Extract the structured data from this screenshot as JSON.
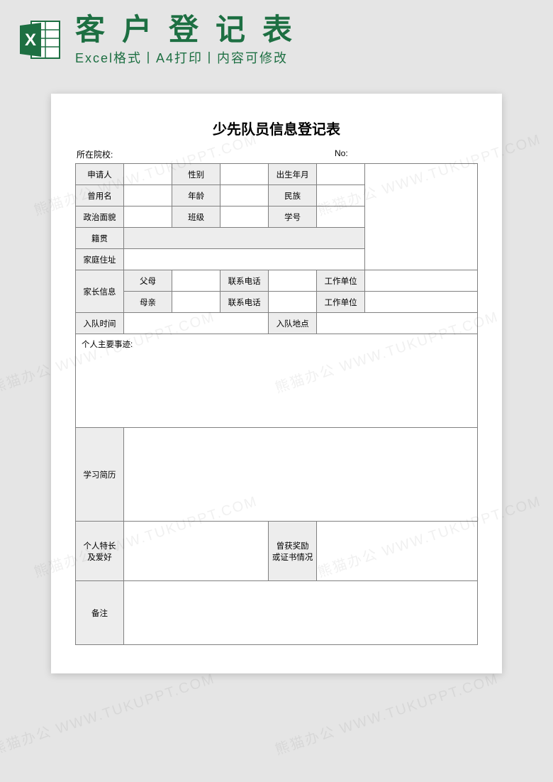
{
  "banner": {
    "title": "客户登记表",
    "subtitle": "Excel格式丨A4打印丨内容可修改"
  },
  "form": {
    "title": "少先队员信息登记表",
    "meta_school": "所在院校:",
    "meta_no": "No:",
    "labels": {
      "applicant": "申请人",
      "gender": "性别",
      "birth": "出生年月",
      "former_name": "曾用名",
      "age": "年龄",
      "ethnicity": "民族",
      "political": "政治面貌",
      "class": "班级",
      "student_no": "学号",
      "native_place": "籍贯",
      "home_addr": "家庭住址",
      "parent_info": "家长信息",
      "father": "父母",
      "mother": "母亲",
      "phone": "联系电话",
      "work_unit": "工作单位",
      "join_time": "入队时间",
      "join_place": "入队地点",
      "main_deeds": "个人主要事迹:",
      "study_cv": "学习简历",
      "hobbies": "个人特长\n及爱好",
      "awards": "曾获奖励\n或证书情况",
      "remarks": "备注"
    }
  },
  "watermark": "熊猫办公 WWW.TUKUPPT.COM"
}
